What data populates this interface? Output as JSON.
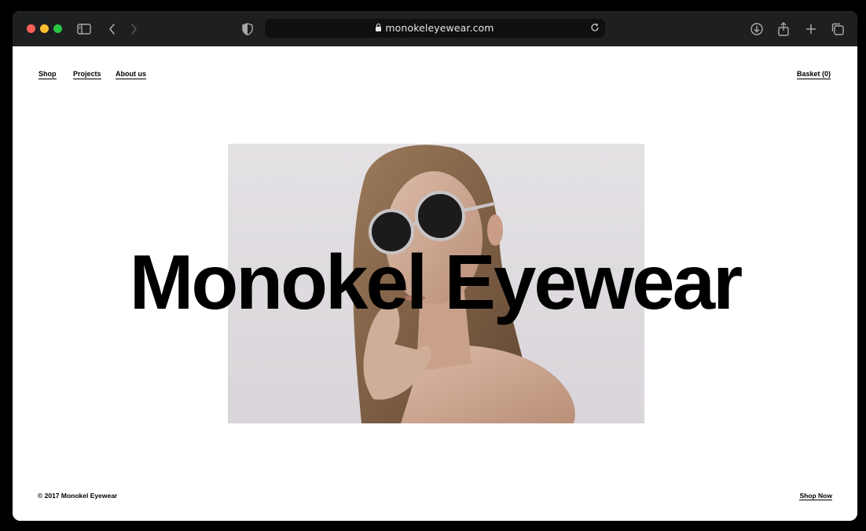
{
  "browser": {
    "url": "monokeleyewear.com",
    "icons": [
      "close-traffic-light",
      "minimize-traffic-light",
      "zoom-traffic-light",
      "sidebar-icon",
      "back-icon",
      "forward-icon",
      "shield-icon",
      "lock-icon",
      "reload-icon",
      "download-icon",
      "share-icon",
      "new-tab-icon",
      "tabs-overview-icon"
    ]
  },
  "nav": {
    "links": [
      "Shop",
      "Projects",
      "About us"
    ],
    "basket": "Basket (0)"
  },
  "hero": {
    "title": "Monokel Eyewear",
    "image": "model-wearing-round-sunglasses"
  },
  "footer": {
    "copyright": "© 2017 Monokel Eyewear",
    "cta": "Shop Now"
  },
  "colors": {
    "chrome": "#1e1f21",
    "urlbar": "#0e0f10",
    "page_bg": "#ffffff",
    "text": "#000000"
  }
}
